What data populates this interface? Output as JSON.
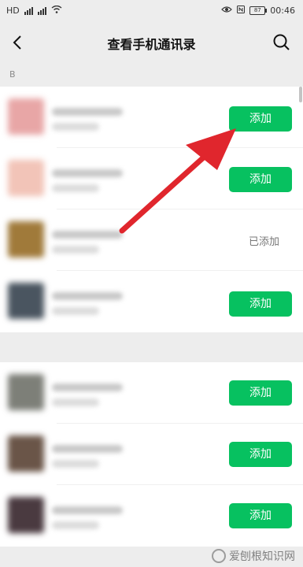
{
  "status_bar": {
    "left_indicators": [
      "HD",
      "4G",
      "4G"
    ],
    "time": "00:46",
    "battery": "87"
  },
  "nav": {
    "title": "查看手机通讯录"
  },
  "sections": [
    {
      "label": "B",
      "contacts": [
        {
          "avatar_color": "#e8a6a6",
          "action": "add"
        },
        {
          "avatar_color": "#f2c4b8",
          "action": "add"
        },
        {
          "avatar_color": "#a07a3a",
          "action": "added"
        },
        {
          "avatar_color": "#4a5560",
          "action": "add"
        }
      ]
    },
    {
      "label": "",
      "contacts": [
        {
          "avatar_color": "#7d7f78",
          "action": "add"
        },
        {
          "avatar_color": "#6a5548",
          "action": "add"
        },
        {
          "avatar_color": "#4a3a40",
          "action": "add"
        }
      ]
    }
  ],
  "labels": {
    "add": "添加",
    "added": "已添加"
  },
  "watermark": "爱刨根知识网",
  "colors": {
    "accent": "#07c160",
    "background": "#ededed",
    "arrow": "#e0262d"
  }
}
